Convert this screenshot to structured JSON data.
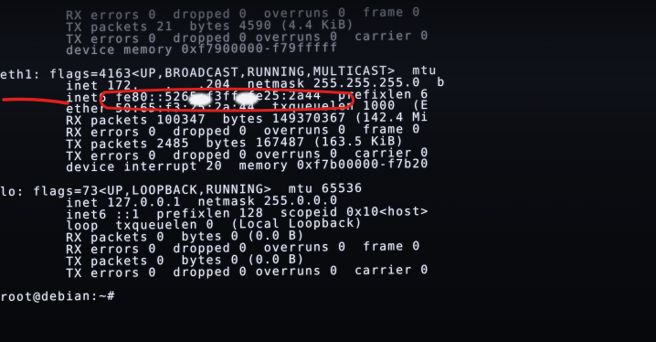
{
  "terminal": {
    "lines": [
      "        RX errors 0  dropped 0  overruns 0  frame 0",
      "        TX packets 21  bytes 4590 (4.4 KiB)",
      "        TX errors 0  dropped 0 overruns 0  carrier 0",
      "        device memory 0xf7900000-f79fffff",
      "",
      "eth1: flags=4163<UP,BROADCAST,RUNNING,MULTICAST>  mtu",
      "        inet 172.   .   .204  netmask 255.255.255.0  b",
      "        inet6 fe80::5265:f3ff:fe25:2a44  prefixlen 6",
      "        ether 50:65:f3:25:2a:44  txqueuelen 1000  (E",
      "        RX packets 100347  bytes 149370367 (142.4 Mi",
      "        RX errors 0  dropped 0  overruns 0  frame 0",
      "        TX packets 2485  bytes 167487 (163.5 KiB)",
      "        TX errors 0  dropped 0 overruns 0  carrier 0",
      "        device interrupt 20  memory 0xf7b00000-f7b20",
      "",
      "lo: flags=73<UP,LOOPBACK,RUNNING>  mtu 65536",
      "        inet 127.0.0.1  netmask 255.0.0.0",
      "        inet6 ::1  prefixlen 128  scopeid 0x10<host>",
      "        loop  txqueuelen 0  (Local Loopback)",
      "        RX packets 0  bytes 0 (0.0 B)",
      "        RX errors 0  dropped 0  overruns 0  frame 0",
      "        TX packets 0  bytes 0 (0.0 B)",
      "        TX errors 0  dropped 0 overruns 0  carrier 0",
      "",
      "root@debian:~#"
    ],
    "prompt": "root@debian:~#"
  },
  "colors": {
    "screen_bg": "#0b0d12",
    "text": "#e8e9f2",
    "annotation_ink": "#e0201c"
  },
  "annotations": [
    {
      "kind": "underline",
      "target": "eth1 interface name"
    },
    {
      "kind": "rounded-box",
      "target": "eth1 inet address line"
    }
  ]
}
